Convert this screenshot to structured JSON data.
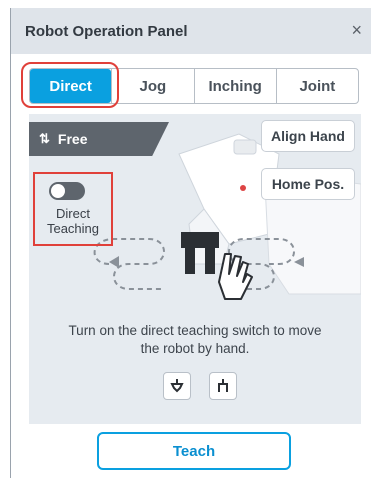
{
  "window": {
    "title": "Robot Operation Panel",
    "close_glyph": "×"
  },
  "tabs": [
    {
      "label": "Direct",
      "active": true
    },
    {
      "label": "Jog",
      "active": false
    },
    {
      "label": "Inching",
      "active": false
    },
    {
      "label": "Joint",
      "active": false
    }
  ],
  "mode": {
    "icon": "free-move-icon",
    "label": "Free"
  },
  "direct_teaching": {
    "label_line1": "Direct",
    "label_line2": "Teaching",
    "enabled": false
  },
  "side_buttons": {
    "align_hand": "Align Hand",
    "home_pos": "Home Pos."
  },
  "hint": {
    "line1": "Turn on the direct teaching switch to move",
    "line2": "the robot by hand."
  },
  "tool_buttons": [
    {
      "icon": "gripper-open-icon"
    },
    {
      "icon": "gripper-close-icon"
    }
  ],
  "footer": {
    "teach_label": "Teach"
  },
  "colors": {
    "accent": "#0aa0e0",
    "highlight": "#e0403a",
    "dark": "#5e656d"
  }
}
